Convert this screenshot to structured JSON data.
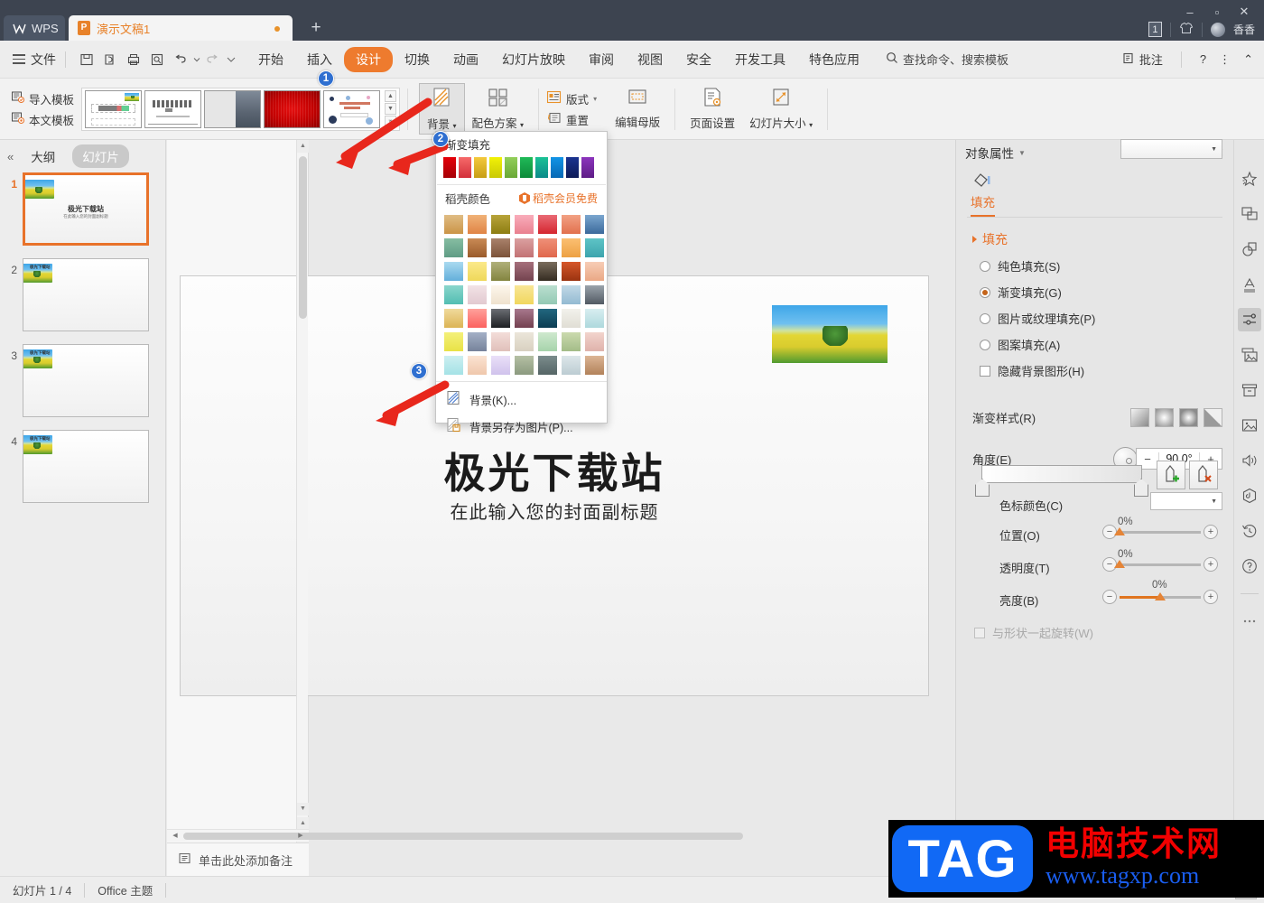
{
  "titlebar": {
    "wps_label": "WPS",
    "doc_tab": {
      "icon": "presentation-icon",
      "label": "演示文稿1",
      "badge": "P"
    },
    "new_tab": "+",
    "window_buttons": {
      "minimize": "–",
      "maximize": "▫",
      "close": "✕"
    },
    "account": {
      "count_badge": "1",
      "name": "香香"
    }
  },
  "menubar": {
    "file_label": "文件",
    "quick_icons": [
      "save-icon",
      "print-preview-icon",
      "print-icon",
      "find-icon",
      "undo-icon",
      "redo-icon",
      "customize-icon"
    ],
    "tabs": [
      {
        "label": "开始",
        "active": false
      },
      {
        "label": "插入",
        "active": false
      },
      {
        "label": "设计",
        "active": true
      },
      {
        "label": "切换",
        "active": false
      },
      {
        "label": "动画",
        "active": false
      },
      {
        "label": "幻灯片放映",
        "active": false
      },
      {
        "label": "审阅",
        "active": false
      },
      {
        "label": "视图",
        "active": false
      },
      {
        "label": "安全",
        "active": false
      },
      {
        "label": "开发工具",
        "active": false
      },
      {
        "label": "特色应用",
        "active": false
      }
    ],
    "search_placeholder": "查找命令、搜索模板",
    "right_items": [
      {
        "label": "批注",
        "icon": "comment-icon"
      },
      {
        "label": "?",
        "icon": "help-icon"
      },
      {
        "label": "⋮",
        "icon": "more-icon"
      },
      {
        "label": "⌃",
        "icon": "collapse-ribbon-icon"
      }
    ]
  },
  "ribbon": {
    "import_template": "导入模板",
    "local_template": "本文模板",
    "background": "背景",
    "color_scheme": "配色方案",
    "layout": "版式",
    "reset": "重置",
    "edit_master": "编辑母版",
    "page_setup": "页面设置",
    "slide_size": "幻灯片大小",
    "template_thumbs": [
      {
        "name": "template-thumb-1"
      },
      {
        "name": "template-thumb-2"
      },
      {
        "name": "template-thumb-3"
      },
      {
        "name": "template-thumb-4"
      },
      {
        "name": "template-thumb-5"
      }
    ]
  },
  "left_panel": {
    "collapse": "«",
    "tab_outline": "大纲",
    "tab_slides": "幻灯片",
    "slides": [
      {
        "number": "1",
        "title": "极光下载站",
        "subtitle": "在此输入您的封面副标题",
        "active": true,
        "kind": "cover"
      },
      {
        "number": "2",
        "title": "极光下载站",
        "active": false,
        "kind": "content"
      },
      {
        "number": "3",
        "title": "极光下载站",
        "active": false,
        "kind": "content"
      },
      {
        "number": "4",
        "title": "极光下载站",
        "active": false,
        "kind": "content"
      }
    ]
  },
  "slide": {
    "title": "极光下载站",
    "subtitle": "在此输入您的封面副标题",
    "image_alt": "canola-field-with-tree-photo"
  },
  "notes": {
    "placeholder": "单击此处添加备注",
    "icon": "notes-icon"
  },
  "background_menu": {
    "header": "渐变填充",
    "standard_colors": [
      "#c90007",
      "#ef4646",
      "#edb72d",
      "#e3e308",
      "#7fc442",
      "#18a64b",
      "#17b089",
      "#0a7ed0",
      "#11246f",
      "#7a2aa6"
    ],
    "docer_label": "稻壳颜色",
    "docer_vip": "稻壳会员免费",
    "docer_vip_icon": "docer-hex-icon",
    "gradient_swatches": [
      [
        "#d8a85c",
        "#e8975a",
        "#a8901f",
        "#f49bac",
        "#e04b52",
        "#ed8963",
        "#5a87b6"
      ],
      [
        "#76ae97",
        "#b96f3f",
        "#9a6c52",
        "#d08a88",
        "#eb7f63",
        "#f0ad57",
        "#4cb6bd"
      ],
      [
        "#87c2e0",
        "#f5e071",
        "#9b9c55",
        "#8d5c65",
        "#534639",
        "#bc4a22",
        "#f0b79a"
      ],
      [
        "#72c8c0",
        "#e9d8dc",
        "#f4ece0",
        "#f5dd77",
        "#a6d6c2",
        "#a9c7dc",
        "#777f88"
      ],
      [
        "#e6c476",
        "#fb7673",
        "#3c3e45",
        "#8d566b",
        "#175772",
        "#e6e6df",
        "#bfe0e2"
      ],
      [
        "#f0e85c",
        "#8e9bb4",
        "#e7c9c4",
        "#e2dccd",
        "#b7dcbd",
        "#b5c89a",
        "#e7c3bb"
      ],
      [
        "#b7e5e8",
        "#f4d5c0",
        "#ddd2ef",
        "#9fae92",
        "#677b7c",
        "#c8d7da",
        "#c69d7c"
      ]
    ],
    "items": [
      {
        "label": "背景(K)...",
        "icon": "background-icon"
      },
      {
        "label": "背景另存为图片(P)...",
        "icon": "save-background-image-icon"
      }
    ]
  },
  "right_panel": {
    "title": "对象属性",
    "close_icon": "close-icon",
    "tab": "填充",
    "tab_icon": "shape-fill-icon",
    "section_fill": "填充",
    "fill_options": [
      {
        "label": "纯色填充(S)",
        "selected": false
      },
      {
        "label": "渐变填充(G)",
        "selected": true
      },
      {
        "label": "图片或纹理填充(P)",
        "selected": false
      },
      {
        "label": "图案填充(A)",
        "selected": false
      }
    ],
    "hide_background_graphics": {
      "label": "隐藏背景图形(H)",
      "checked": false
    },
    "gradient_style_label": "渐变样式(R)",
    "gradient_styles": [
      "linear-icon",
      "radial-icon",
      "rectangular-icon",
      "path-icon"
    ],
    "angle_label": "角度(E)",
    "angle_value": "90.0°",
    "angle_minus": "−",
    "angle_plus": "+",
    "stop_add_icon": "add-gradient-stop-icon",
    "stop_remove_icon": "remove-gradient-stop-icon",
    "stop_color_label": "色标颜色(C)",
    "sliders": [
      {
        "label": "位置(O)",
        "value": "0%",
        "fill_pct": 0
      },
      {
        "label": "透明度(T)",
        "value": "0%",
        "fill_pct": 0
      },
      {
        "label": "亮度(B)",
        "value": "0%",
        "fill_pct": 50
      }
    ],
    "rotate_with_shape": {
      "label": "与形状一起旋转(W)",
      "checked": false,
      "disabled": true
    }
  },
  "rail_icons": [
    "effects-star-icon",
    "transition-icon",
    "shape-combine-icon",
    "word-art-icon",
    "object-properties-icon",
    "image-group-icon",
    "archive-icon",
    "picture-icon",
    "audio-icon",
    "badge-icon",
    "history-icon",
    "help-circle-icon",
    "more-dots-icon"
  ],
  "statusbar": {
    "slide_count": "幻灯片 1 / 4",
    "theme": "Office 主题",
    "view_list_icon": "view-list-icon",
    "view_normal_icon": "view-normal-icon"
  },
  "annotations": [
    {
      "number": "1",
      "target": "template-gallery"
    },
    {
      "number": "2",
      "target": "background-button"
    },
    {
      "number": "3",
      "target": "background-menu-item"
    }
  ],
  "watermark": {
    "logo_text": "TAG",
    "site_name": "电脑技术网",
    "url": "www.tagxp.com",
    "logo_color": "#1169f5",
    "name_color": "#f20000",
    "url_color": "#1a5ef0"
  }
}
